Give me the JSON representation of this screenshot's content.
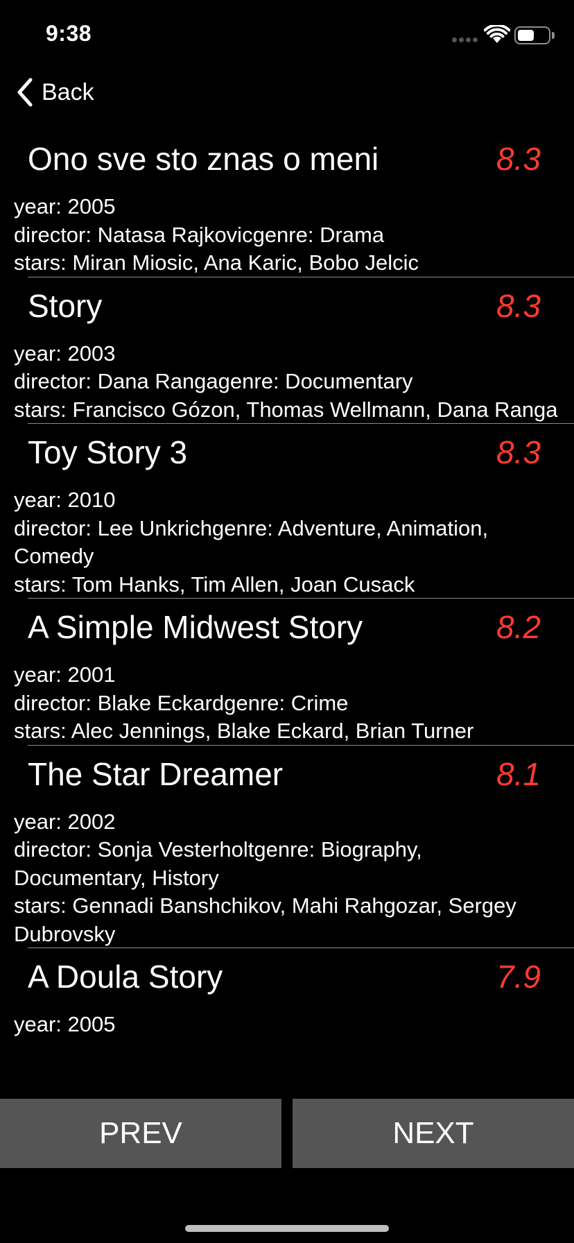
{
  "status_bar": {
    "time": "9:38",
    "battery_level": 0.55
  },
  "nav": {
    "back_label": "Back"
  },
  "movies": [
    {
      "title": "Ono sve sto znas o meni",
      "rating": "8.3",
      "year_line": "year: 2005",
      "director_genre_line": "director: Natasa Rajkovicgenre: Drama",
      "stars_line": "stars: Miran Miosic, Ana Karic, Bobo Jelcic"
    },
    {
      "title": "Story",
      "rating": "8.3",
      "year_line": "year: 2003",
      "director_genre_line": "director: Dana Rangagenre: Documentary",
      "stars_line": "stars: Francisco Gózon, Thomas Wellmann, Dana Ranga"
    },
    {
      "title": "Toy Story 3",
      "rating": "8.3",
      "year_line": "year: 2010",
      "director_genre_line": "director: Lee Unkrichgenre: Adventure, Animation, Comedy",
      "stars_line": "stars: Tom Hanks, Tim Allen, Joan Cusack"
    },
    {
      "title": "A Simple Midwest Story",
      "rating": "8.2",
      "year_line": "year: 2001",
      "director_genre_line": "director: Blake Eckardgenre: Crime",
      "stars_line": "stars: Alec Jennings, Blake Eckard, Brian Turner"
    },
    {
      "title": "The Star Dreamer",
      "rating": "8.1",
      "year_line": "year: 2002",
      "director_genre_line": "director: Sonja Vesterholtgenre: Biography, Documentary, History",
      "stars_line": "stars: Gennadi Banshchikov, Mahi Rahgozar, Sergey Dubrovsky"
    },
    {
      "title": "A Doula Story",
      "rating": "7.9",
      "year_line": "year: 2005",
      "director_genre_line": "",
      "stars_line": ""
    }
  ],
  "pager": {
    "prev_label": "PREV",
    "next_label": "NEXT"
  },
  "colors": {
    "rating": "#ff3b30",
    "button_bg": "#555555",
    "background": "#000000"
  }
}
